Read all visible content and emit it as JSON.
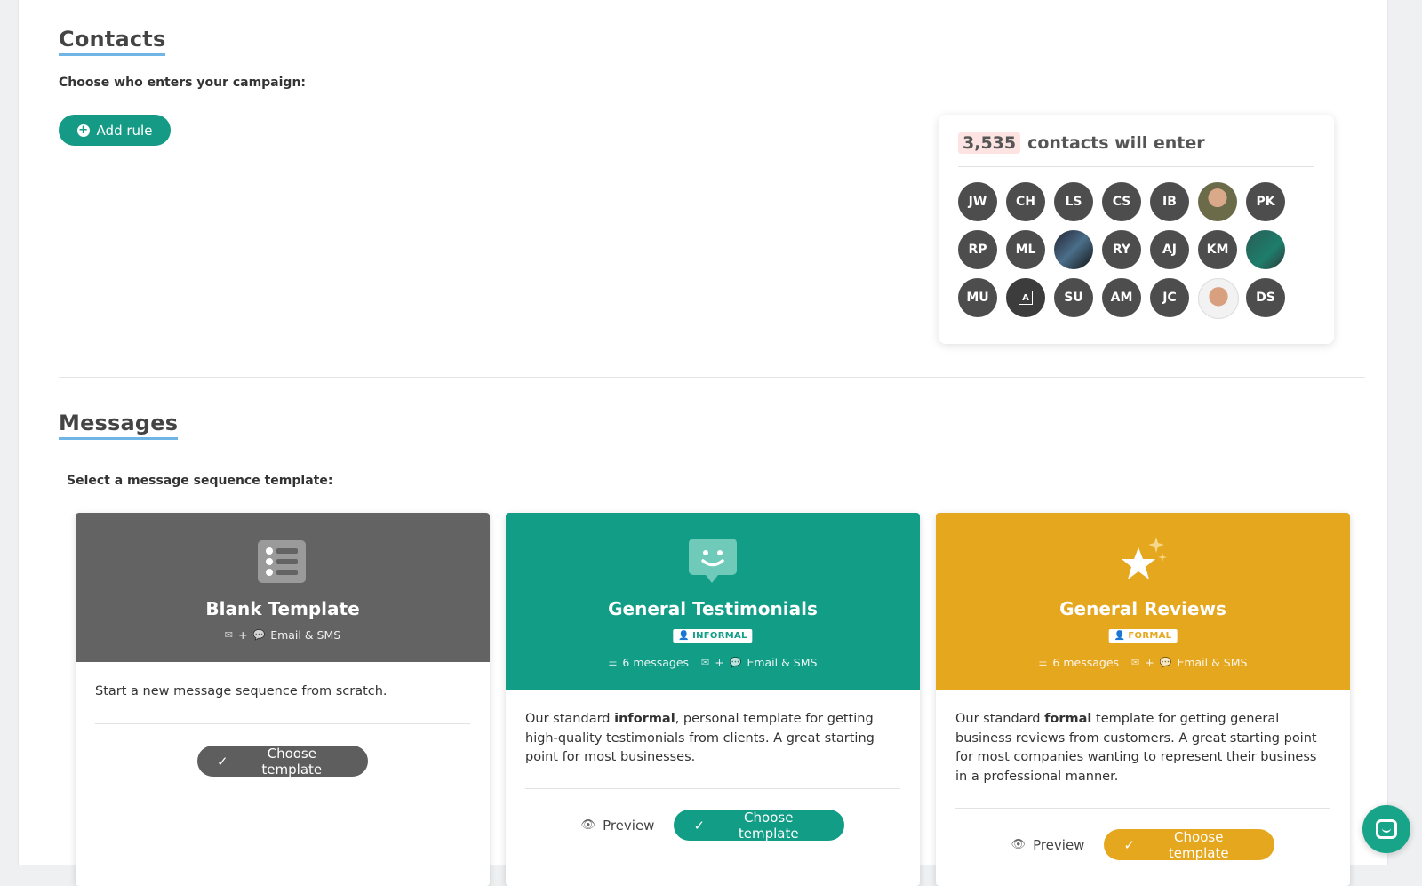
{
  "contacts": {
    "title": "Contacts",
    "subtitle": "Choose who enters your campaign:",
    "add_rule_label": "Add rule",
    "summary": {
      "count": "3,535",
      "label": "contacts will enter",
      "avatars": [
        "JW",
        "CH",
        "LS",
        "CS",
        "IB",
        "",
        "PK",
        "RP",
        "ML",
        "",
        "RY",
        "AJ",
        "KM",
        "",
        "MU",
        "A",
        "SU",
        "AM",
        "JC",
        "",
        "DS"
      ]
    }
  },
  "messages": {
    "title": "Messages",
    "subtitle": "Select a message sequence template:",
    "templates": [
      {
        "title": "Blank Template",
        "channels": "Email & SMS",
        "description": "Start a new message sequence from scratch.",
        "choose_label": "Choose template",
        "color": "#636363"
      },
      {
        "title": "General Testimonials",
        "tag": "INFORMAL",
        "messages_count": "6 messages",
        "channels": "Email & SMS",
        "desc_pre": "Our standard ",
        "desc_bold": "informal",
        "desc_post": ", personal template for getting high-quality testimonials from clients. A great starting point for most businesses.",
        "preview_label": "Preview",
        "choose_label": "Choose template",
        "color": "#129d87"
      },
      {
        "title": "General Reviews",
        "tag": "FORMAL",
        "messages_count": "6 messages",
        "channels": "Email & SMS",
        "desc_pre": "Our standard ",
        "desc_bold": "formal",
        "desc_post": " template for getting general business reviews from customers. A great starting point for most companies wanting to represent their business in a professional manner.",
        "preview_label": "Preview",
        "choose_label": "Choose template",
        "color": "#e5a71e"
      }
    ]
  },
  "channel_join": "+"
}
